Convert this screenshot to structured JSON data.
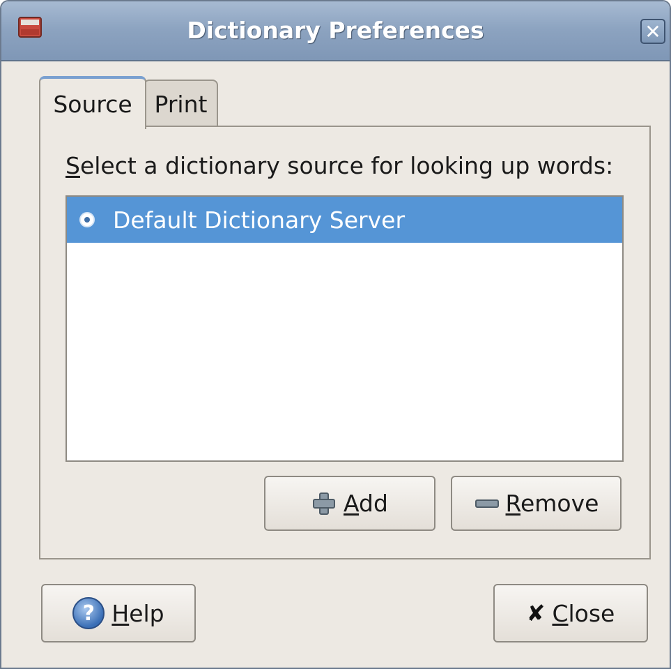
{
  "window": {
    "title": "Dictionary Preferences",
    "close_glyph": "✕"
  },
  "tabs": [
    {
      "label": "Source",
      "active": true
    },
    {
      "label": "Print",
      "active": false
    }
  ],
  "source_page": {
    "label_mnemonic": "S",
    "label_rest": "elect a dictionary source for looking up words:",
    "sources": [
      {
        "name": "Default Dictionary Server",
        "selected": true
      }
    ],
    "add_button": {
      "mnemonic": "A",
      "rest": "dd",
      "icon": "plus-icon"
    },
    "remove_button": {
      "mnemonic": "R",
      "rest": "emove",
      "icon": "minus-icon"
    }
  },
  "footer": {
    "help_button": {
      "mnemonic": "H",
      "rest": "elp",
      "icon": "help-icon",
      "icon_glyph": "?"
    },
    "close_button": {
      "mnemonic": "C",
      "rest": "lose",
      "icon": "close-icon",
      "icon_glyph": "✘"
    }
  },
  "colors": {
    "selection": "#5595d6",
    "titlebar": "#8ca3c0",
    "window_bg": "#ede9e3"
  }
}
